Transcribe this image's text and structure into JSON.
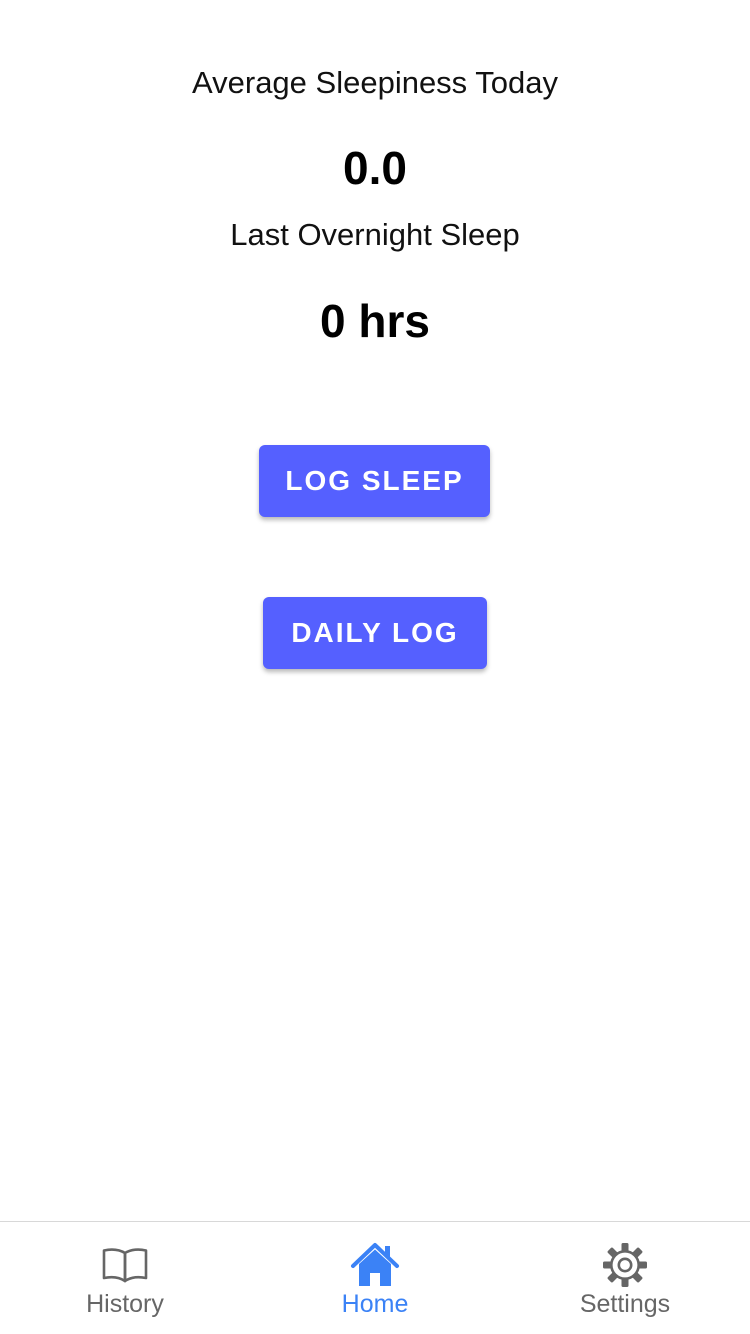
{
  "stats": {
    "average_sleepiness_label": "Average Sleepiness Today",
    "average_sleepiness_value": "0.0",
    "last_sleep_label": "Last Overnight Sleep",
    "last_sleep_value": "0 hrs"
  },
  "actions": {
    "log_sleep_label": "LOG SLEEP",
    "daily_log_label": "DAILY LOG"
  },
  "tabbar": {
    "active_tab": "Home",
    "tabs": [
      {
        "label": "History",
        "icon": "book-open-icon"
      },
      {
        "label": "Home",
        "icon": "home-icon"
      },
      {
        "label": "Settings",
        "icon": "gear-icon"
      }
    ]
  },
  "colors": {
    "button_bg": "#5560FF",
    "button_text": "#FFFFFF",
    "tab_active": "#3B82F6",
    "tab_inactive": "#666666"
  }
}
